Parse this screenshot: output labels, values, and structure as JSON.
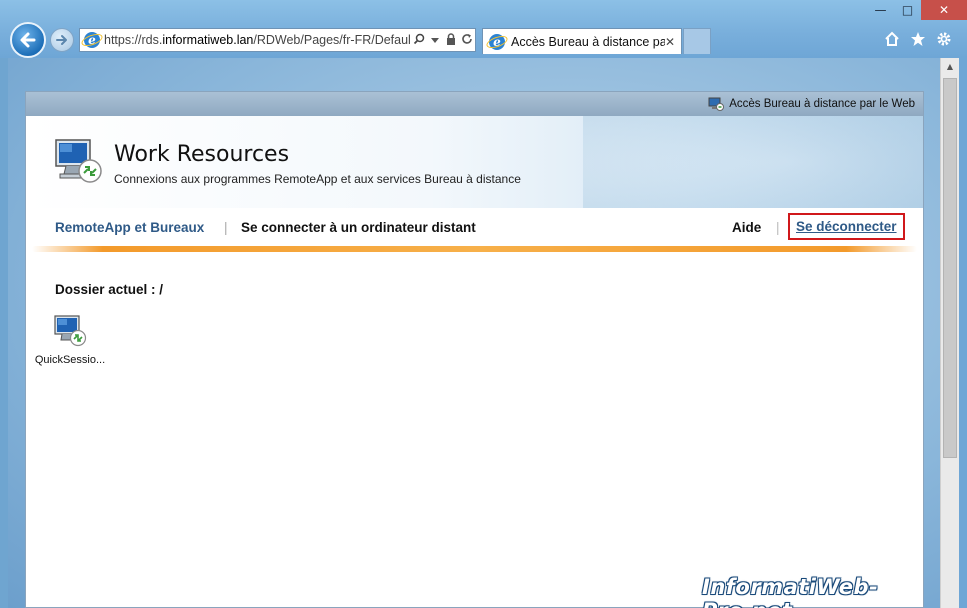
{
  "browser": {
    "address_url_prefix": "https://rds.",
    "address_url_domain": "informatiweb.lan",
    "address_url_path": "/RDWeb/Pages/fr-FR/Default",
    "tab_title": "Accès Bureau à distance pa...",
    "tab_close": "✕",
    "minimize": "—",
    "maximize": "□",
    "close": "✕"
  },
  "topbar": {
    "label": "Accès Bureau à distance par le Web"
  },
  "header": {
    "title": "Work Resources",
    "subtitle": "Connexions aux programmes RemoteApp et aux services Bureau à distance"
  },
  "nav": {
    "remoteapp": "RemoteApp et Bureaux",
    "separator": "|",
    "connect": "Se connecter à un ordinateur distant",
    "help": "Aide",
    "logout": "Se déconnecter"
  },
  "main": {
    "folder_label": "Dossier actuel : /",
    "apps": [
      {
        "name": "QuickSessio..."
      }
    ]
  },
  "watermark": "InformatiWeb-Pro.net",
  "icons": [
    "back-arrow-icon",
    "forward-arrow-icon",
    "ie-icon",
    "search-icon",
    "dropdown-icon",
    "lock-icon",
    "refresh-icon",
    "home-icon",
    "star-icon",
    "gear-icon",
    "remote-desktop-icon"
  ]
}
